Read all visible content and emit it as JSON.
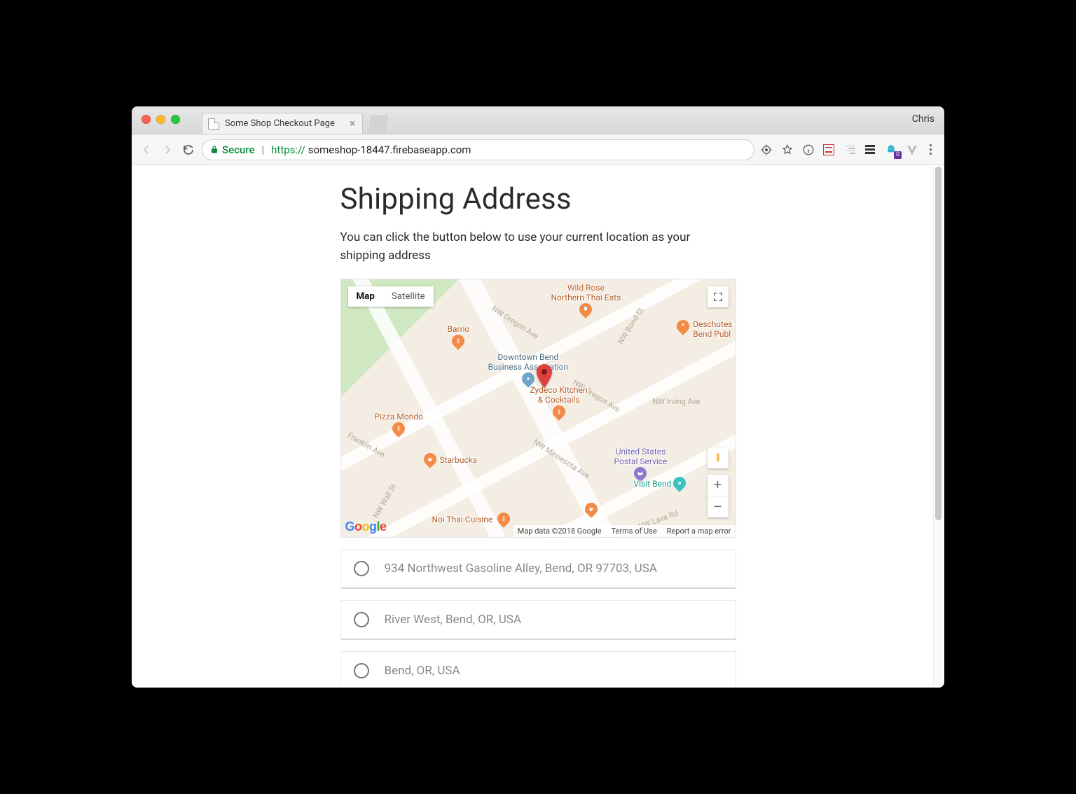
{
  "chrome": {
    "profile_name": "Chris",
    "tab_title": "Some Shop Checkout Page",
    "secure_label": "Secure",
    "url_protocol": "https://",
    "url_rest": "someshop-18447.firebaseapp.com",
    "ghost_badge": "0"
  },
  "page": {
    "heading": "Shipping Address",
    "lead": "You can click the button below to use your current location as your shipping address"
  },
  "map": {
    "type_map": "Map",
    "type_satellite": "Satellite",
    "zoom_in": "+",
    "zoom_out": "−",
    "attribution": {
      "data": "Map data ©2018 Google",
      "terms": "Terms of Use",
      "report": "Report a map error"
    },
    "streets": {
      "nw_oregon": "NW Oregon Ave",
      "nw_minnesota": "NW Minnesota Ave",
      "nw_irving": "NW Irving Ave",
      "nw_bond": "NW Bond St",
      "franklin": "Franklin Ave",
      "nw_wall": "NW Wall St",
      "nw_lava": "NW Lava Rd"
    },
    "pois": {
      "wild_rose": "Wild Rose\nNorthern Thai Eats",
      "barrio": "Barrio",
      "downtown_assoc": "Downtown Bend\nBusiness Association",
      "zydeco": "Zydeco Kitchen\n& Cocktails",
      "deschutes": "Deschutes\nBend Publ",
      "pizza_mondo": "Pizza Mondo",
      "starbucks": "Starbucks",
      "usps": "United States\nPostal Service",
      "visit_bend": "Visit Bend",
      "noi_thai": "Noi Thai Cuisine"
    }
  },
  "addresses": [
    "934 Northwest Gasoline Alley, Bend, OR 97703, USA",
    "River West, Bend, OR, USA",
    "Bend, OR, USA"
  ]
}
